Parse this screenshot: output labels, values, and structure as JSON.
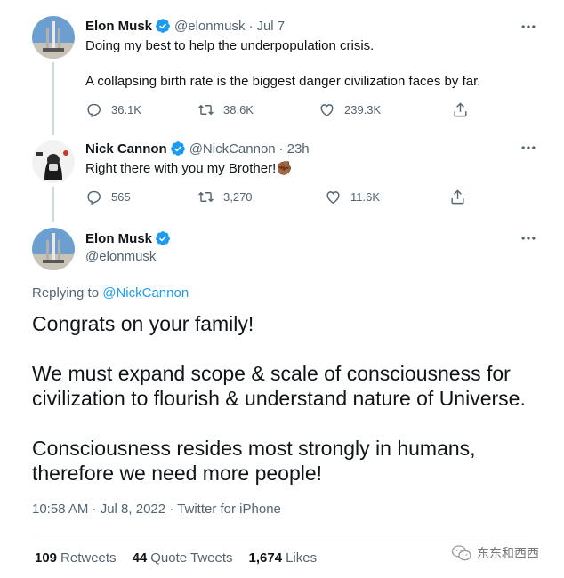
{
  "tweets": [
    {
      "name": "Elon Musk",
      "handle": "@elonmusk",
      "time": "Jul 7",
      "line1": "Doing my best to help the underpopulation crisis.",
      "line2": "A collapsing birth rate is the biggest danger civilization faces by far.",
      "replies": "36.1K",
      "retweets": "38.6K",
      "likes": "239.3K"
    },
    {
      "name": "Nick Cannon",
      "handle": "@NickCannon",
      "time": "23h",
      "line1": "Right there with you my Brother!✊🏾",
      "replies": "565",
      "retweets": "3,270",
      "likes": "11.6K"
    }
  ],
  "main": {
    "name": "Elon Musk",
    "handle": "@elonmusk",
    "replying_prefix": "Replying to ",
    "replying_to": "@NickCannon",
    "para1": "Congrats on your family!",
    "para2a": "We must expand scope & scale of consciousness for",
    "para2b": "civilization to flourish & understand nature of Universe.",
    "para3a": "Consciousness resides most strongly in humans,",
    "para3b": "therefore we need more people!",
    "meta": "10:58 AM · Jul 8, 2022 · Twitter for iPhone",
    "retweet_count": "109",
    "retweet_label": "Retweets",
    "quote_count": "44",
    "quote_label": "Quote Tweets",
    "like_count": "1,674",
    "like_label": "Likes"
  },
  "watermark": "东东和西西",
  "colors": {
    "verified": "#1d9bf0",
    "link": "#1d9bf0",
    "secondary": "#536471",
    "thread_line": "#cfd9de"
  }
}
